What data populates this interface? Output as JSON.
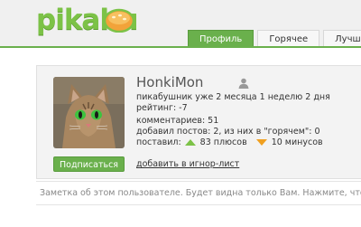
{
  "header": {
    "logo_text": "pikabu",
    "tabs": [
      {
        "label": "Профиль",
        "active": true
      },
      {
        "label": "Горячее",
        "active": false
      },
      {
        "label": "Лучш",
        "active": false
      }
    ]
  },
  "profile": {
    "username": "HonkiMon",
    "membership": "пикабушник уже 2 месяца 1 неделю 2 дня",
    "rating": "рейтинг: -7",
    "comments": "комментариев: 51",
    "posts": "добавил постов: 2, из них в \"горячем\": 0",
    "votes_label": "поставил:",
    "upvotes": "83 плюсов",
    "downvotes": "10 минусов",
    "subscribe_label": "Подписаться",
    "ignore_label": "добавить в игнор-лист"
  },
  "note": {
    "text": "Заметка об этом пользователе. Будет видна только Вам. Нажмите, чтобы"
  },
  "colors": {
    "accent": "#6ab04c",
    "logo": "#7cc247",
    "upvote": "#7cc247",
    "downvote": "#f0a020"
  },
  "icons": [
    "logo-bun-icon",
    "user-icon",
    "upvote-arrow-icon",
    "downvote-arrow-icon"
  ]
}
